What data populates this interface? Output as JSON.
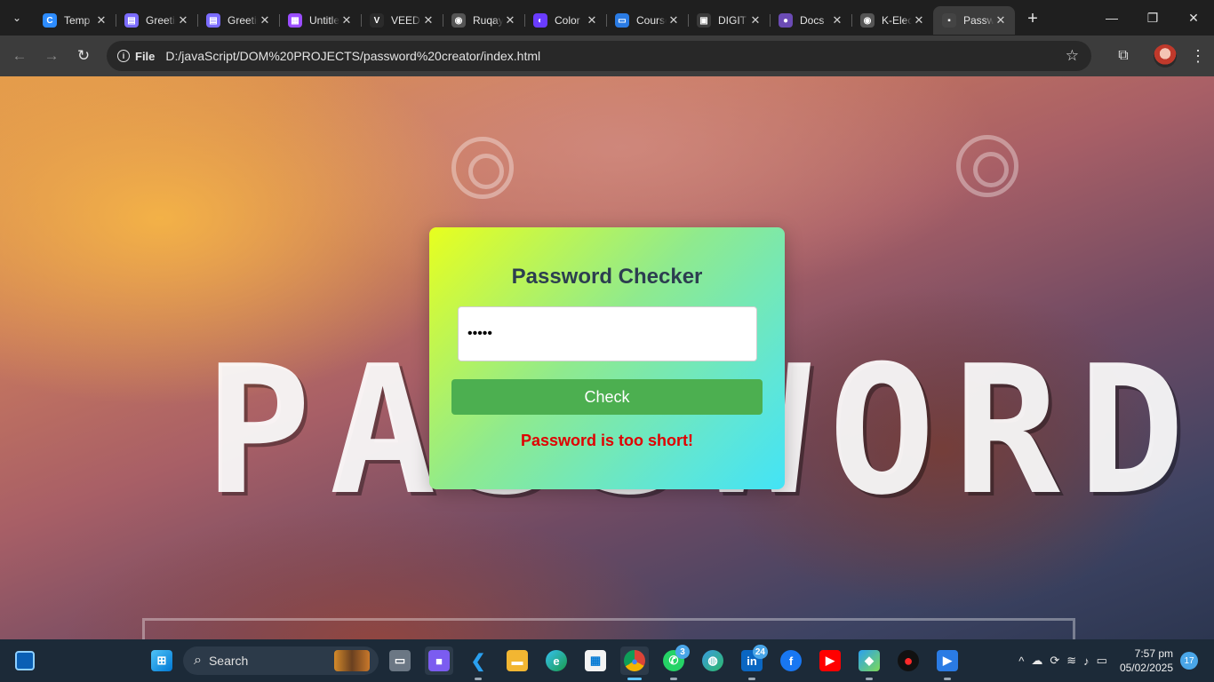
{
  "browser": {
    "tabs": [
      {
        "title": "Temp",
        "favicon": "canva-icon",
        "color": "#2d8cff",
        "glyph": "C"
      },
      {
        "title": "Greetings",
        "favicon": "document-icon",
        "color": "#7b6cff",
        "glyph": "▤"
      },
      {
        "title": "Greetings",
        "favicon": "document-icon",
        "color": "#7b6cff",
        "glyph": "▤"
      },
      {
        "title": "Untitled",
        "favicon": "calendar-icon",
        "color": "#9b4dff",
        "glyph": "▦"
      },
      {
        "title": "VEED",
        "favicon": "veed-icon",
        "color": "#2b2b2b",
        "glyph": "V"
      },
      {
        "title": "Ruqayya",
        "favicon": "globe-icon",
        "color": "#555",
        "glyph": "◉"
      },
      {
        "title": "Color",
        "favicon": "color-icon",
        "color": "#6a3cff",
        "glyph": "◐"
      },
      {
        "title": "Course",
        "favicon": "course-icon",
        "color": "#2a7be4",
        "glyph": "▭"
      },
      {
        "title": "DIGIT",
        "favicon": "digit-icon",
        "color": "#3a3a3a",
        "glyph": "▣"
      },
      {
        "title": "Docs",
        "favicon": "docs-icon",
        "color": "#6b4bb5",
        "glyph": "●"
      },
      {
        "title": "K-Electric",
        "favicon": "globe-icon",
        "color": "#555",
        "glyph": "◉"
      },
      {
        "title": "Password Checker",
        "favicon": "page-icon",
        "color": "#444",
        "glyph": "▪"
      }
    ],
    "new_tab": "+",
    "site_chip": "File",
    "url": "D:/javaScript/DOM%20PROJECTS/password%20creator/index.html"
  },
  "page": {
    "title": "Password Checker",
    "password_value": "•••••",
    "check_label": "Check",
    "message": "Password is too short!",
    "message_color": "#e00000",
    "button_color": "#4caf50"
  },
  "taskbar": {
    "search_label": "Search",
    "whatsapp_badge": "3",
    "linkedin_badge": "24",
    "time": "7:57 pm",
    "date": "05/02/2025",
    "notifications": "17"
  }
}
